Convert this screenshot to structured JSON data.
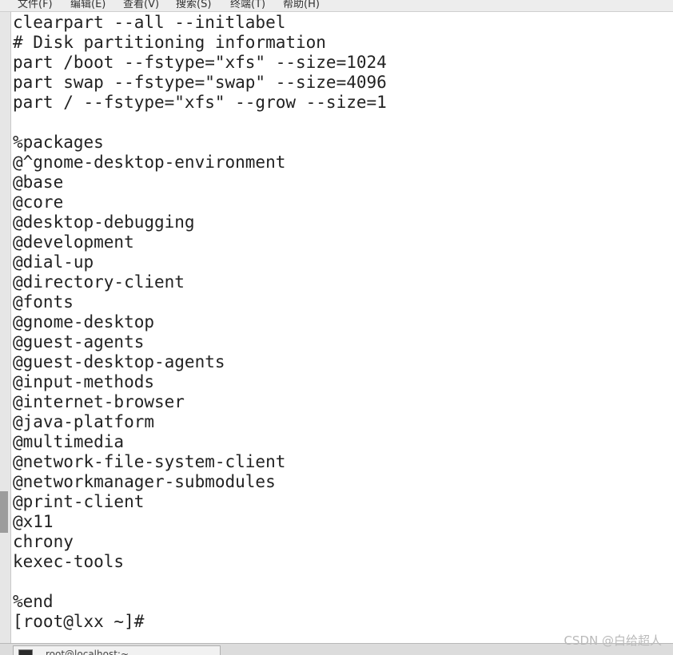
{
  "menubar": {
    "items": [
      "文件(F)",
      "编辑(E)",
      "查看(V)",
      "搜索(S)",
      "终端(T)",
      "帮助(H)"
    ]
  },
  "terminal": {
    "lines": [
      "clearpart --all --initlabel",
      "# Disk partitioning information",
      "part /boot --fstype=\"xfs\" --size=1024",
      "part swap --fstype=\"swap\" --size=4096",
      "part / --fstype=\"xfs\" --grow --size=1",
      "",
      "%packages",
      "@^gnome-desktop-environment",
      "@base",
      "@core",
      "@desktop-debugging",
      "@development",
      "@dial-up",
      "@directory-client",
      "@fonts",
      "@gnome-desktop",
      "@guest-agents",
      "@guest-desktop-agents",
      "@input-methods",
      "@internet-browser",
      "@java-platform",
      "@multimedia",
      "@network-file-system-client",
      "@networkmanager-submodules",
      "@print-client",
      "@x11",
      "chrony",
      "kexec-tools",
      "",
      "%end",
      "[root@lxx ~]#"
    ]
  },
  "taskbar": {
    "tab_label": "root@localhost:~"
  },
  "watermark": "CSDN @白给超人"
}
